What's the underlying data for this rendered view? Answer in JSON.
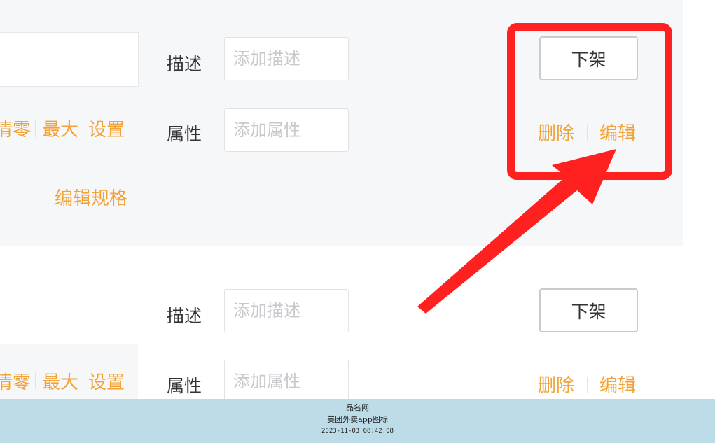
{
  "product1": {
    "desc_label": "描述",
    "desc_placeholder": "添加描述",
    "attr_label": "属性",
    "attr_placeholder": "添加属性",
    "stock_actions": [
      "清零",
      "最大",
      "设置"
    ],
    "edit_spec": "编辑规格",
    "offshelf_label": "下架",
    "delete_label": "删除",
    "edit_label": "编辑"
  },
  "product2": {
    "desc_label": "描述",
    "desc_placeholder": "添加描述",
    "attr_label": "属性",
    "attr_placeholder": "添加属性",
    "stock_actions": [
      "清零",
      "最大",
      "设置"
    ],
    "offshelf_label": "下架",
    "delete_label": "删除",
    "edit_label": "编辑"
  },
  "annotation": {
    "color": "#ff2020"
  },
  "watermark": {
    "site": "品名网",
    "title": "美团外卖app图标",
    "timestamp": "2023-11-03 08:42:08"
  },
  "colors": {
    "link": "#f2a236",
    "row_bg": "#f6f7f9",
    "footer_bg": "#bcdde8"
  }
}
